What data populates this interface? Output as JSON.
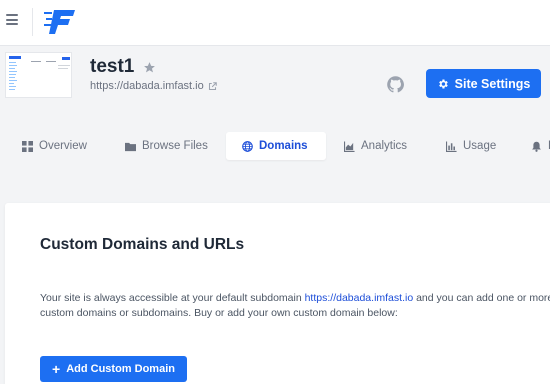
{
  "header": {
    "logo_alt": "imfast-logo"
  },
  "site": {
    "name": "test1",
    "url": "https://dabada.imfast.io",
    "settings_label": "Site Settings"
  },
  "tabs": [
    {
      "label": "Overview",
      "icon": "grid-icon",
      "active": false
    },
    {
      "label": "Browse Files",
      "icon": "folder-icon",
      "active": false
    },
    {
      "label": "Domains",
      "icon": "globe-icon",
      "active": true
    },
    {
      "label": "Analytics",
      "icon": "area-chart-icon",
      "active": false
    },
    {
      "label": "Usage",
      "icon": "bar-chart-icon",
      "active": false
    },
    {
      "label": "B",
      "icon": "bell-icon",
      "active": false
    }
  ],
  "domains": {
    "heading": "Custom Domains and URLs",
    "desc_before": "Your site is always accessible at your default subdomain ",
    "desc_link": "https://dabada.imfast.io",
    "desc_after": " and you can add one or more custom domains or subdomains. Buy or add your own custom domain below:",
    "add_button_label": "Add Custom Domain"
  },
  "colors": {
    "accent": "#1d6ff2",
    "link": "#1d4ed8",
    "page_bg": "#f3f4f6"
  }
}
